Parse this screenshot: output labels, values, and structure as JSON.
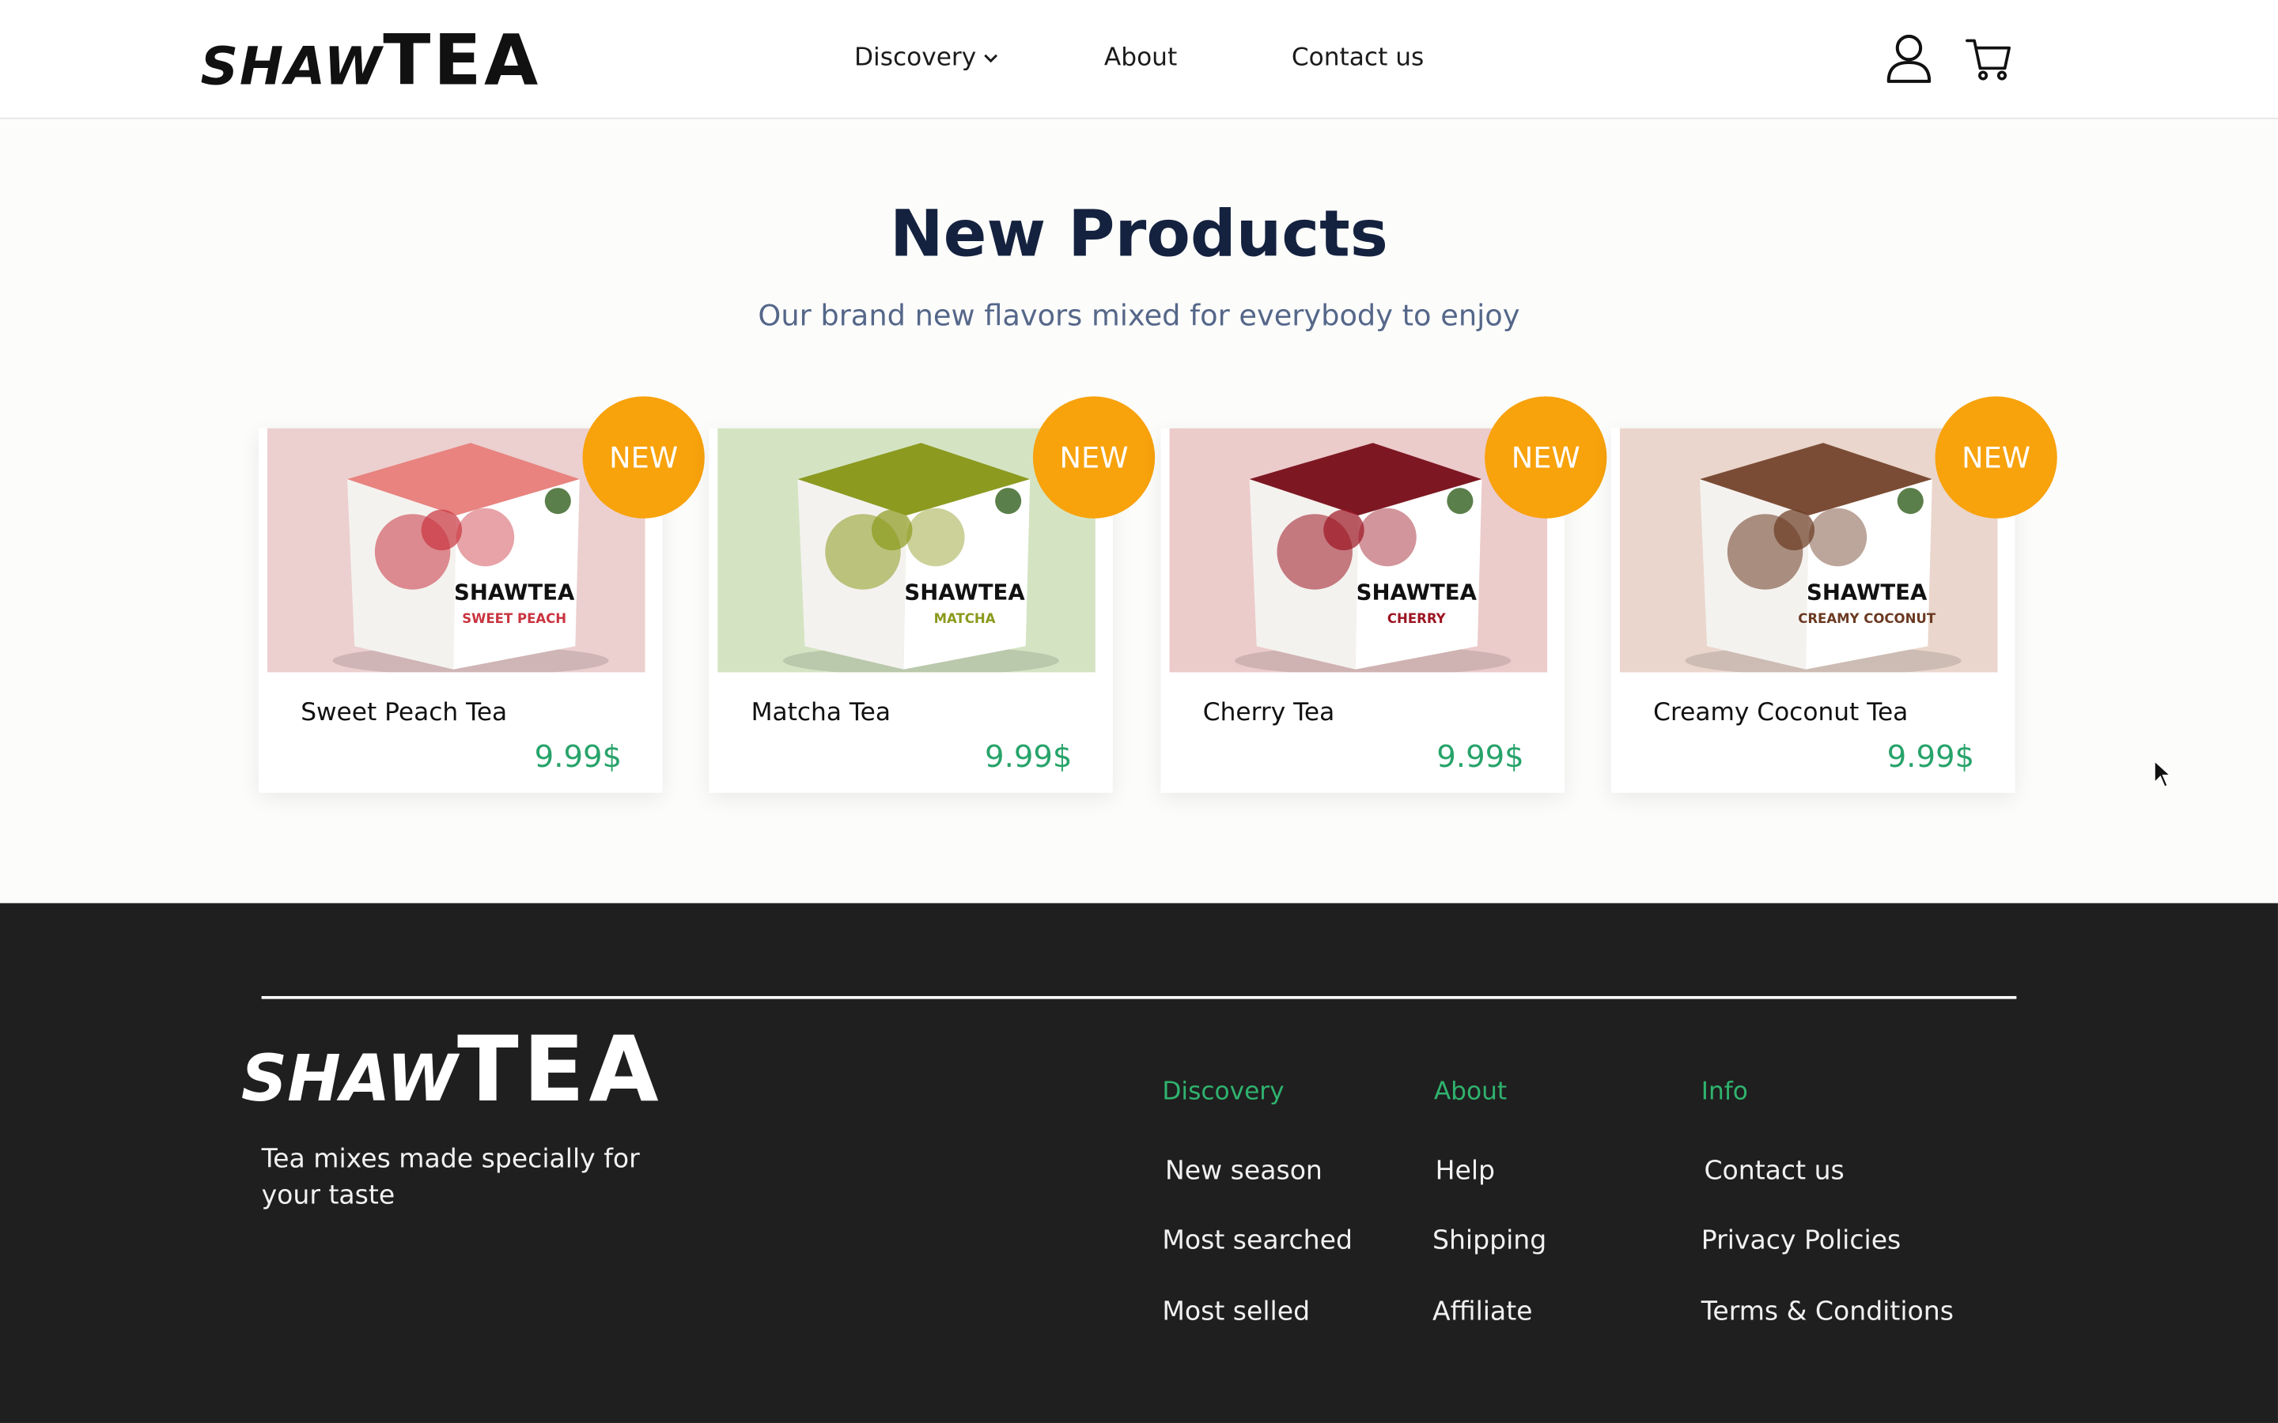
{
  "header": {
    "logo": {
      "small": "SHAW",
      "big": "TEA"
    },
    "nav": [
      {
        "label": "Discovery"
      },
      {
        "label": "About"
      },
      {
        "label": "Contact us"
      }
    ],
    "icons": [
      "user-icon",
      "cart-icon"
    ]
  },
  "section": {
    "title": "New Products",
    "subtitle": "Our brand new flavors mixed for everybody to enjoy"
  },
  "products": [
    {
      "name": "Sweet Peach Tea",
      "price": "9.99$",
      "badge": "NEW",
      "box_label": "SWEET PEACH",
      "bg": "#eccfcf",
      "box_top": "#e8837f",
      "accent": "#c9343f"
    },
    {
      "name": "Matcha Tea",
      "price": "9.99$",
      "badge": "NEW",
      "box_label": "MATCHA",
      "bg": "#d4e4c3",
      "box_top": "#8c9a20",
      "accent": "#8b9a1c"
    },
    {
      "name": "Cherry Tea",
      "price": "9.99$",
      "badge": "NEW",
      "box_label": "CHERRY",
      "bg": "#eccbcb",
      "box_top": "#7d1822",
      "accent": "#9c1522"
    },
    {
      "name": "Creamy Coconut Tea",
      "price": "9.99$",
      "badge": "NEW",
      "box_label": "CREAMY COCONUT",
      "bg": "#ead6cc",
      "box_top": "#7b4c35",
      "accent": "#6b3a22"
    }
  ],
  "box_brand": "SHAWTEA",
  "footer": {
    "logo": {
      "small": "SHAW",
      "big": "TEA"
    },
    "tagline": "Tea mixes made specially for your taste",
    "columns": [
      {
        "heading": "Discovery",
        "links": [
          "New season",
          "Most searched",
          "Most selled"
        ]
      },
      {
        "heading": "About",
        "links": [
          "Help",
          "Shipping",
          "Affiliate"
        ]
      },
      {
        "heading": "Info",
        "links": [
          "Contact us",
          "Privacy Policies",
          "Terms & Conditions"
        ]
      }
    ]
  },
  "colors": {
    "accent_green": "#27a36a",
    "badge_orange": "#f8a20c",
    "title_navy": "#14223f",
    "footer_bg": "#1f1f1f"
  }
}
